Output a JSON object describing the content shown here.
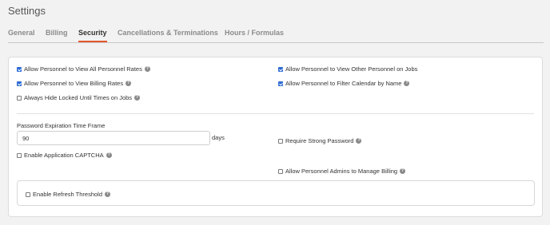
{
  "page": {
    "title": "Settings"
  },
  "tabs": [
    {
      "label": "General"
    },
    {
      "label": "Billing"
    },
    {
      "label": "Security"
    },
    {
      "label": "Cancellations & Terminations"
    },
    {
      "label": "Hours / Formulas"
    }
  ],
  "active_tab": "Security",
  "colors": {
    "accent": "#e4572e",
    "checkbox": "#2a6ad4"
  },
  "options": {
    "view_all_rates": {
      "label": "Allow Personnel to View All Personnel Rates",
      "checked": true
    },
    "view_billing_rates": {
      "label": "Allow Personnel to View Billing Rates",
      "checked": true
    },
    "hide_locked": {
      "label": "Always Hide Locked Until Times on Jobs",
      "checked": false
    },
    "view_other_personnel": {
      "label": "Allow Personnel to View Other Personnel on Jobs",
      "checked": true
    },
    "filter_calendar": {
      "label": "Allow Personnel to Filter Calendar by Name",
      "checked": true
    },
    "require_strong_password": {
      "label": "Require Strong Password",
      "checked": false
    },
    "enable_captcha": {
      "label": "Enable Application CAPTCHA",
      "checked": false
    },
    "admins_manage_billing": {
      "label": "Allow Personnel Admins to Manage Billing",
      "checked": false
    },
    "refresh_threshold": {
      "label": "Enable Refresh Threshold",
      "checked": false
    }
  },
  "password": {
    "label": "Password Expiration Time Frame",
    "value": "90",
    "unit": "days"
  }
}
